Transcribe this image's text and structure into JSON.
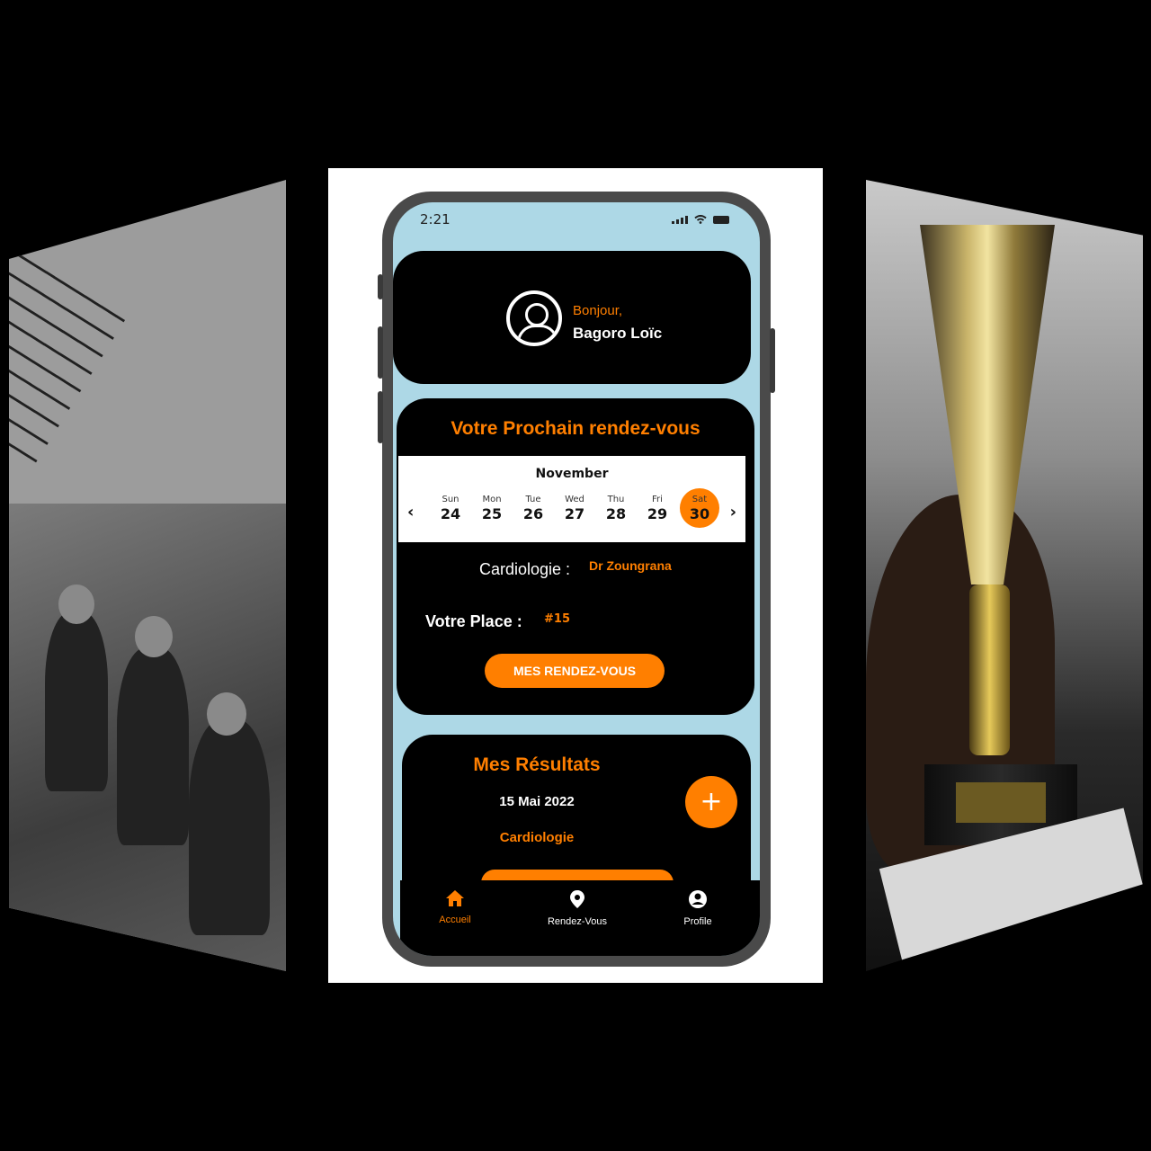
{
  "app": {
    "status_time": "2:21",
    "greeting": "Bonjour,",
    "user_name": "Bagoro Loïc"
  },
  "appointment": {
    "title": "Votre Prochain rendez-vous",
    "calendar": {
      "month": "November",
      "days": [
        {
          "name": "Sun",
          "date": "24"
        },
        {
          "name": "Mon",
          "date": "25"
        },
        {
          "name": "Tue",
          "date": "26"
        },
        {
          "name": "Wed",
          "date": "27"
        },
        {
          "name": "Thu",
          "date": "28"
        },
        {
          "name": "Fri",
          "date": "29"
        },
        {
          "name": "Sat",
          "date": "30"
        }
      ],
      "selected": "30"
    },
    "specialty_label": "Cardiologie :",
    "doctor": "Dr Zoungrana",
    "place_label": "Votre Place :",
    "place_value": "#15",
    "button_label": "MES RENDEZ-VOUS"
  },
  "results": {
    "title": "Mes Résultats",
    "date": "15 Mai 2022",
    "specialty": "Cardiologie",
    "fab_label": "+"
  },
  "nav": {
    "items": [
      {
        "label": "Accueil",
        "icon": "home-icon",
        "active": true
      },
      {
        "label": "Rendez-Vous",
        "icon": "location-pin-icon",
        "active": false
      },
      {
        "label": "Profile",
        "icon": "profile-icon",
        "active": false
      }
    ]
  },
  "colors": {
    "accent": "#ff7f00",
    "card_bg": "#000000",
    "screen_bg": "#add8e6"
  }
}
